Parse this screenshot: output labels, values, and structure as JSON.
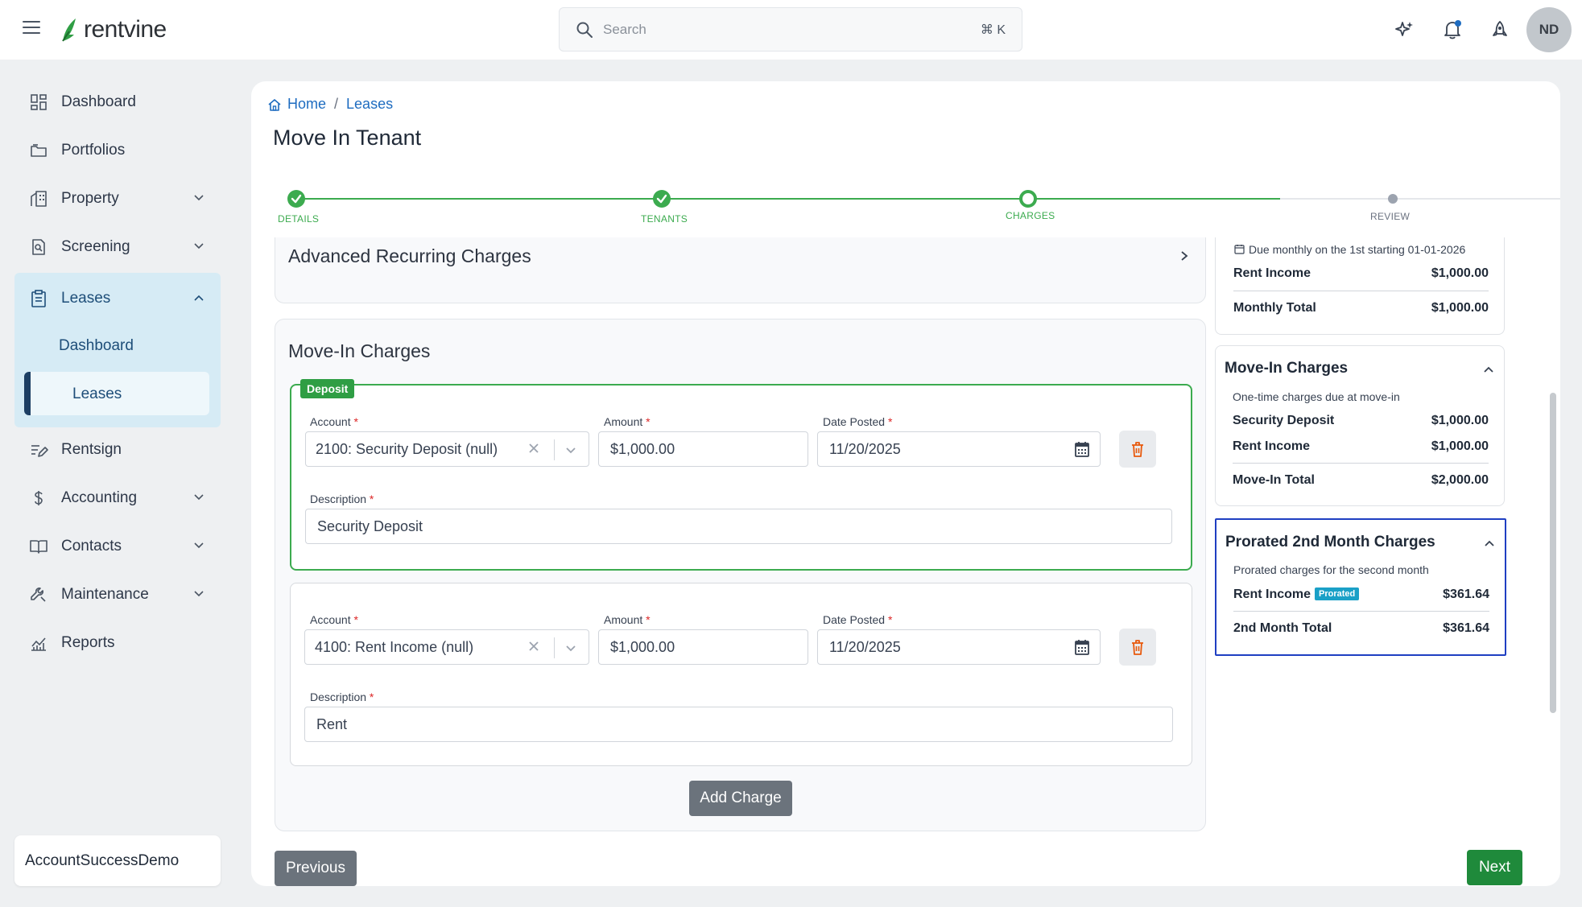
{
  "brand": {
    "name": "rentvine",
    "accent": "#3cab4f"
  },
  "topbar": {
    "search_placeholder": "Search",
    "search_shortcut": "⌘ K",
    "icons": [
      "sparkle-icon",
      "bell-icon",
      "rocket-icon"
    ],
    "avatar_initials": "ND"
  },
  "sidebar": {
    "items": [
      {
        "label": "Dashboard",
        "icon": "dashboard-icon"
      },
      {
        "label": "Portfolios",
        "icon": "folder-icon"
      },
      {
        "label": "Property",
        "icon": "building-icon"
      },
      {
        "label": "Screening",
        "icon": "screening-icon"
      },
      {
        "label": "Leases",
        "icon": "clipboard-icon"
      },
      {
        "label": "Rentsign",
        "icon": "sign-icon"
      },
      {
        "label": "Accounting",
        "icon": "dollar-icon"
      },
      {
        "label": "Contacts",
        "icon": "book-icon"
      },
      {
        "label": "Maintenance",
        "icon": "wrench-icon"
      },
      {
        "label": "Reports",
        "icon": "chart-icon"
      }
    ],
    "leases_sub": [
      "Dashboard",
      "Leases"
    ],
    "account_name": "AccountSuccessDemo"
  },
  "breadcrumb": {
    "home": "Home",
    "current": "Leases"
  },
  "page_title": "Move In Tenant",
  "stepper": {
    "steps": [
      "DETAILS",
      "TENANTS",
      "CHARGES",
      "REVIEW"
    ]
  },
  "advanced": {
    "title": "Advanced Recurring Charges"
  },
  "move_in": {
    "title": "Move-In Charges",
    "deposit_badge": "Deposit",
    "labels": {
      "account": "Account",
      "amount": "Amount",
      "date": "Date Posted",
      "description": "Description",
      "req": "*"
    },
    "charges": [
      {
        "account": "2100: Security Deposit (null)",
        "amount": "$1,000.00",
        "date": "11/20/2025",
        "description": "Security Deposit"
      },
      {
        "account": "4100: Rent Income (null)",
        "amount": "$1,000.00",
        "date": "11/20/2025",
        "description": "Rent"
      }
    ],
    "add_charge": "Add Charge"
  },
  "nav_buttons": {
    "previous": "Previous",
    "next": "Next"
  },
  "summary": {
    "recurring": {
      "due_text": "Due monthly on the 1st starting 01-01-2026",
      "rows": [
        {
          "label": "Rent Income",
          "value": "$1,000.00"
        }
      ],
      "total_label": "Monthly Total",
      "total_value": "$1,000.00"
    },
    "move_in": {
      "title": "Move-In Charges",
      "subtitle": "One-time charges due at move-in",
      "rows": [
        {
          "label": "Security Deposit",
          "value": "$1,000.00"
        },
        {
          "label": "Rent Income",
          "value": "$1,000.00"
        }
      ],
      "total_label": "Move-In Total",
      "total_value": "$2,000.00"
    },
    "prorated": {
      "title": "Prorated 2nd Month Charges",
      "subtitle": "Prorated charges for the second month",
      "row_label": "Rent Income",
      "row_badge": "Prorated",
      "row_value": "$361.64",
      "total_label": "2nd Month Total",
      "total_value": "$361.64"
    }
  }
}
